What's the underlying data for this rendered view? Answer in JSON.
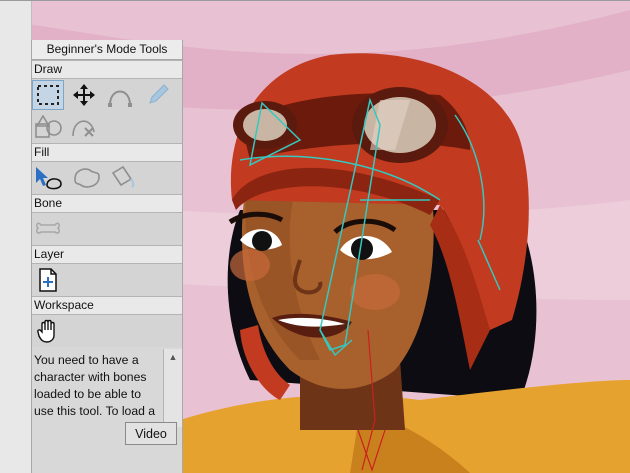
{
  "panel": {
    "title": "Beginner's Mode Tools",
    "sections": {
      "draw": "Draw",
      "fill": "Fill",
      "bone": "Bone",
      "layer": "Layer",
      "workspace": "Workspace"
    },
    "help_text": "You need to have a character with bones loaded to be able to use this tool. To load a",
    "video_label": "Video"
  },
  "icons": {
    "draw": [
      "select-points-icon",
      "transform-icon",
      "curve-icon",
      "pencil-icon",
      "shape-icon",
      "delete-edge-icon"
    ],
    "fill": [
      "select-shape-icon",
      "create-shape-icon",
      "paint-bucket-icon"
    ],
    "bone": [
      "bone-icon"
    ],
    "layer": [
      "new-layer-icon"
    ],
    "workspace": [
      "hand-icon"
    ]
  },
  "colors": {
    "background": "#e9c4d3",
    "helmet": "#c23a1f",
    "skin": "#a55a2a",
    "bone_overlay": "#35c8c0"
  }
}
